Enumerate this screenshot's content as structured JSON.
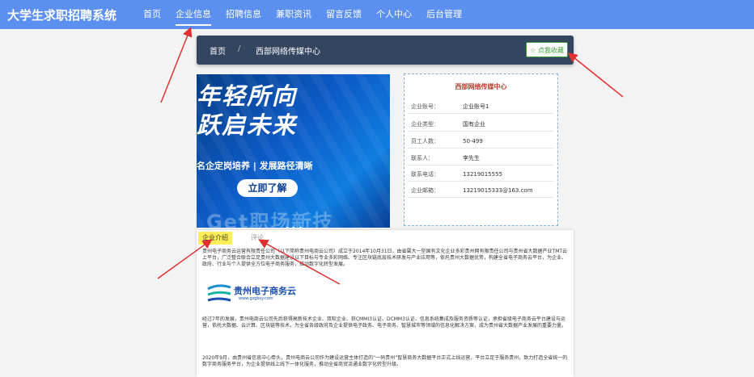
{
  "navbar": {
    "brand": "大学生求职招聘系统",
    "items": [
      {
        "label": "首页"
      },
      {
        "label": "企业信息"
      },
      {
        "label": "招聘信息"
      },
      {
        "label": "兼职资讯"
      },
      {
        "label": "留言反馈"
      },
      {
        "label": "个人中心"
      },
      {
        "label": "后台管理"
      }
    ],
    "active_index": 1
  },
  "breadcrumb": {
    "home": "首页",
    "separator": "/",
    "current": "西部网络传媒中心"
  },
  "favorite_button": "☆ 点我收藏",
  "banner": {
    "line1": "年轻所向",
    "line2": "跃启未来",
    "line3": "名企定岗培养 | 发展路径清晰",
    "button": "立即了解",
    "watermark": "Get职场新技"
  },
  "company": {
    "title": "西部网络传媒中心",
    "rows": [
      {
        "label": "企业账号：",
        "value": "企业账号1"
      },
      {
        "label": "企业类型：",
        "value": "国有企业"
      },
      {
        "label": "员工人数：",
        "value": "50-499"
      },
      {
        "label": "联系人：",
        "value": "李先生"
      },
      {
        "label": "联系电话：",
        "value": "13219015555"
      },
      {
        "label": "企业邮箱：",
        "value": "13219015333@163.com"
      }
    ]
  },
  "tabs": {
    "items": [
      {
        "label": "企业介绍"
      },
      {
        "label": "评论"
      }
    ],
    "active_index": 0
  },
  "intro": {
    "paragraph1": "贵州电子商务云运营有限责任公司（以下简称贵州电商云公司）成立于2014年10月31日，由省属大一型国有文化企业多彩贵州网有限责任公司与贵州省大数据产业TMT云上平台，广泛整合联合立足贵州大数据建设以下目标与专业多彩网络、专注区块链底层技术研发与产业应用等，依托贵州大数据优势，构建全省电子商务云平台，为企业、政府、行业与个人提供全方位电子商务服务，推动数字化转型发展。",
    "logo_text": "贵州电子商务云",
    "logo_url": "www.gzgbsy.com",
    "paragraph2": "经过7年的发展，贵州电商云公司先后获得高新技术企业、双软企业、获CMMI3认证、DCMM3认证、信息系统集成及服务资质等认证，承担省级电子商务云平台建设与运营，依托大数据、云计算、区块链等技术，为全省各级政府及企业提供电子政务、电子商务、智慧城市等领域的信息化解决方案，成为贵州省大数据产业发展的重要力量。",
    "paragraph3": "2020年9月，由贵州省信息中心牵头，贵州电商云公司作为建设运营主体打造的“一码贵州”智慧商务大数据平台正式上线运营，平台立足于服务贵州，致力打造全省统一的数字商务服务平台，为企业提供线上线下一体化服务，推动全省商贸流通业数字化转型升级。"
  }
}
